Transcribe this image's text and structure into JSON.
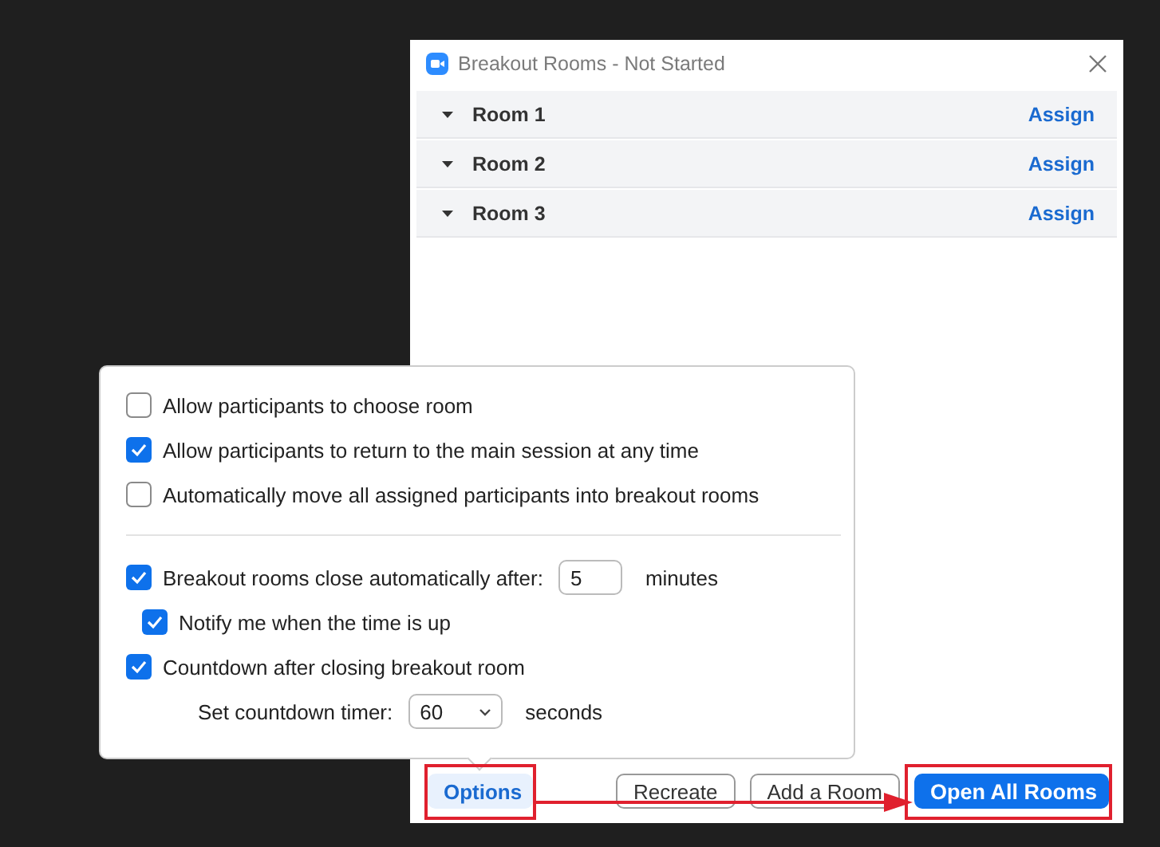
{
  "window": {
    "title": "Breakout Rooms - Not Started"
  },
  "rooms": [
    {
      "name": "Room 1",
      "action": "Assign"
    },
    {
      "name": "Room 2",
      "action": "Assign"
    },
    {
      "name": "Room 3",
      "action": "Assign"
    }
  ],
  "options": [
    {
      "kind": "checkbox",
      "label": "Allow participants to choose room",
      "checked": false
    },
    {
      "kind": "checkbox",
      "label": "Allow participants to return to the main session at any time",
      "checked": true
    },
    {
      "kind": "checkbox",
      "label": "Automatically move all assigned participants into breakout rooms",
      "checked": false
    }
  ],
  "timer_options": [
    {
      "kind": "checkbox",
      "label": "Breakout rooms close automatically after:",
      "checked": true,
      "value": "5",
      "unit": "minutes",
      "children": [
        {
          "kind": "checkbox",
          "label": "Notify me when the time is up",
          "checked": true
        }
      ]
    },
    {
      "kind": "checkbox",
      "label": "Countdown after closing breakout room",
      "checked": true,
      "children": [
        {
          "kind": "select",
          "label": "Set countdown timer:",
          "value": "60",
          "unit": "seconds"
        }
      ]
    }
  ],
  "footer_buttons": [
    {
      "kind": "link",
      "label": "Options",
      "highlighted": true
    },
    {
      "kind": "outline",
      "label": "Recreate",
      "highlighted": false
    },
    {
      "kind": "outline",
      "label": "Add a Room",
      "highlighted": false
    },
    {
      "kind": "primary",
      "label": "Open All Rooms",
      "highlighted": true
    }
  ]
}
